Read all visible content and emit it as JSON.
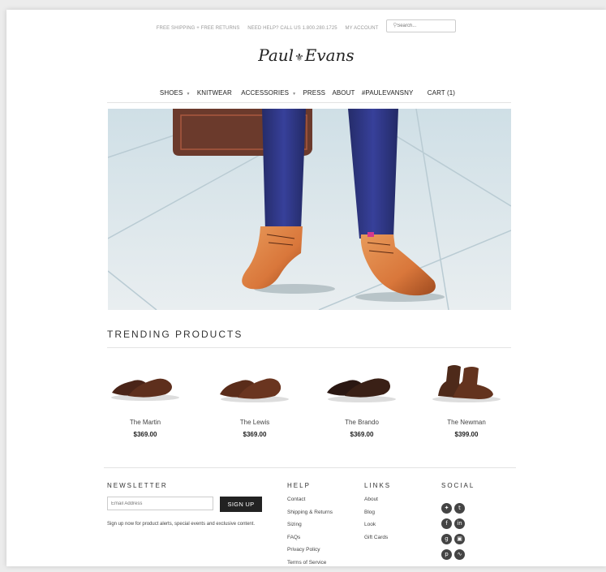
{
  "topbar": {
    "shipping": "FREE SHIPPING + FREE RETURNS",
    "help": "NEED HELP? CALL US 1.800.280.1725",
    "account": "MY ACCOUNT",
    "search_placeholder": "Search..."
  },
  "logo": {
    "first": "Paul",
    "last": "Evans"
  },
  "nav": {
    "shoes": "SHOES",
    "knitwear": "KNITWEAR",
    "accessories": "ACCESSORIES",
    "press": "PRESS",
    "about": "ABOUT",
    "hashtag": "#PAULEVANSNY",
    "cart": "CART (1)"
  },
  "trending": {
    "title": "TRENDING PRODUCTS",
    "products": [
      {
        "name": "The Martin",
        "price": "$369.00"
      },
      {
        "name": "The Lewis",
        "price": "$369.00"
      },
      {
        "name": "The Brando",
        "price": "$369.00"
      },
      {
        "name": "The Newman",
        "price": "$399.00"
      }
    ]
  },
  "footer": {
    "newsletter": {
      "title": "NEWSLETTER",
      "placeholder": "Email Address",
      "button": "SIGN UP",
      "text": "Sign up now for product alerts, special events and exclusive content."
    },
    "help": {
      "title": "HELP",
      "items": [
        "Contact",
        "Shipping & Returns",
        "Sizing",
        "FAQs",
        "Privacy Policy",
        "Terms of Service"
      ]
    },
    "links": {
      "title": "LINKS",
      "items": [
        "About",
        "Blog",
        "Look",
        "Gift Cards"
      ]
    },
    "social": {
      "title": "SOCIAL",
      "icons": [
        "twitter-icon",
        "tumblr-icon",
        "facebook-icon",
        "linkedin-icon",
        "google-plus-icon",
        "instagram-icon",
        "pinterest-icon",
        "rss-icon"
      ]
    }
  },
  "colors": {
    "background": "#ececec",
    "page": "#ffffff",
    "text": "#333333",
    "button": "#222222",
    "shoe_tan": "#d9773b",
    "trouser_navy": "#2c347a"
  }
}
